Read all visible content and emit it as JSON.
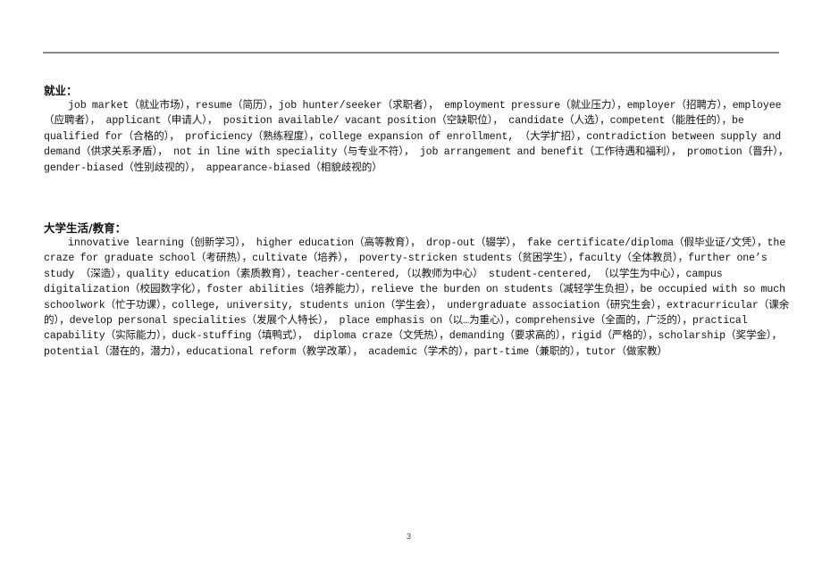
{
  "sections": [
    {
      "heading": "就业：",
      "text": "job market（就业市场），resume（简历），job hunter/seeker（求职者）， employment pressure（就业压力），employer（招聘方），employee（应聘者）， applicant（申请人）， position available/ vacant position（空缺职位）， candidate（人选），competent（能胜任的），be qualified for（合格的），  proficiency（熟练程度），college expansion of enrollment, （大学扩招），contradiction between supply and demand（供求关系矛盾），  not in line with speciality（与专业不符），  job arrangement and benefit（工作待遇和福利）， promotion（晋升），  gender-biased（性别歧视的）， appearance-biased（相貌歧视的）"
    },
    {
      "heading": "大学生活/教育：",
      "text": "innovative learning（创新学习）， higher education（高等教育）， drop-out（辍学）， fake certificate/diploma（假毕业证/文凭），the craze for graduate school（考研热），cultivate（培养）， poverty-stricken students（贫困学生），faculty（全体教员），further one’s study （深造），quality education（素质教育），teacher-centered,（以教师为中心） student-centered, （以学生为中心），campus digitalization（校园数字化），foster abilities（培养能力），relieve the burden on students（减轻学生负担），be occupied with so much schoolwork（忙于功课），college, university, students union（学生会）， undergraduate association（研究生会），extracurricular（课余的），develop personal specialities（发展个人特长）， place emphasis on（以…为重心），comprehensive（全面的，广泛的），practical capability（实际能力），duck-stuffing（填鸭式）， diploma craze（文凭热），demanding（要求高的），rigid（严格的），scholarship（奖学金），potential（潜在的，潜力），educational reform（教学改革）， academic（学术的），part-time（兼职的），tutor（做家教）"
    }
  ],
  "footer": {
    "page_number": "3"
  }
}
